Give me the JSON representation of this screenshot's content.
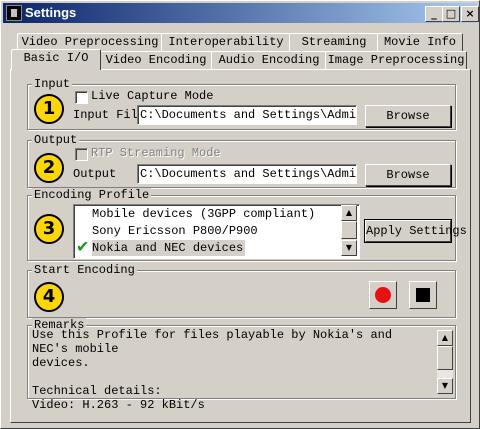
{
  "window": {
    "title": "Settings",
    "minimize_glyph": "_",
    "maximize_glyph": "□",
    "close_glyph": "×"
  },
  "tabs": {
    "row1": [
      "Video Preprocessing",
      "Interoperability",
      "Streaming",
      "Movie Info"
    ],
    "row2": [
      "Basic I/O",
      "Video Encoding",
      "Audio Encoding",
      "Image Preprocessing"
    ],
    "active": "Basic I/O"
  },
  "input": {
    "group_label": "Input",
    "step": "1",
    "live_capture_label": "Live Capture Mode",
    "live_capture_checked": false,
    "file_label": "Input File",
    "file_value": "C:\\Documents and Settings\\Administra",
    "browse_label": "Browse"
  },
  "output": {
    "group_label": "Output",
    "step": "2",
    "rtp_label": "RTP Streaming Mode",
    "rtp_enabled": false,
    "file_label": "Output",
    "file_value": "C:\\Documents and Settings\\Administra",
    "browse_label": "Browse"
  },
  "profile": {
    "group_label": "Encoding Profile",
    "step": "3",
    "items": [
      "Mobile devices (3GPP compliant)",
      "Sony Ericsson P800/P900",
      "Nokia and NEC devices"
    ],
    "selected_index": 2,
    "apply_label": "Apply Settings",
    "checkmark_glyph": "✔"
  },
  "start": {
    "group_label": "Start Encoding",
    "step": "4",
    "record_icon": "record-icon",
    "stop_icon": "stop-icon",
    "record_color": "#e81010"
  },
  "remarks": {
    "group_label": "Remarks",
    "text": "Use this Profile for files playable by Nokia's and NEC's mobile\ndevices.\n\nTechnical details:\nVideo: H.263 - 92 kBit/s"
  },
  "colors": {
    "title_start": "#0a246a",
    "title_end": "#a6caf0",
    "step_circle": "#ffd700",
    "checkmark": "#1a9a1a"
  }
}
